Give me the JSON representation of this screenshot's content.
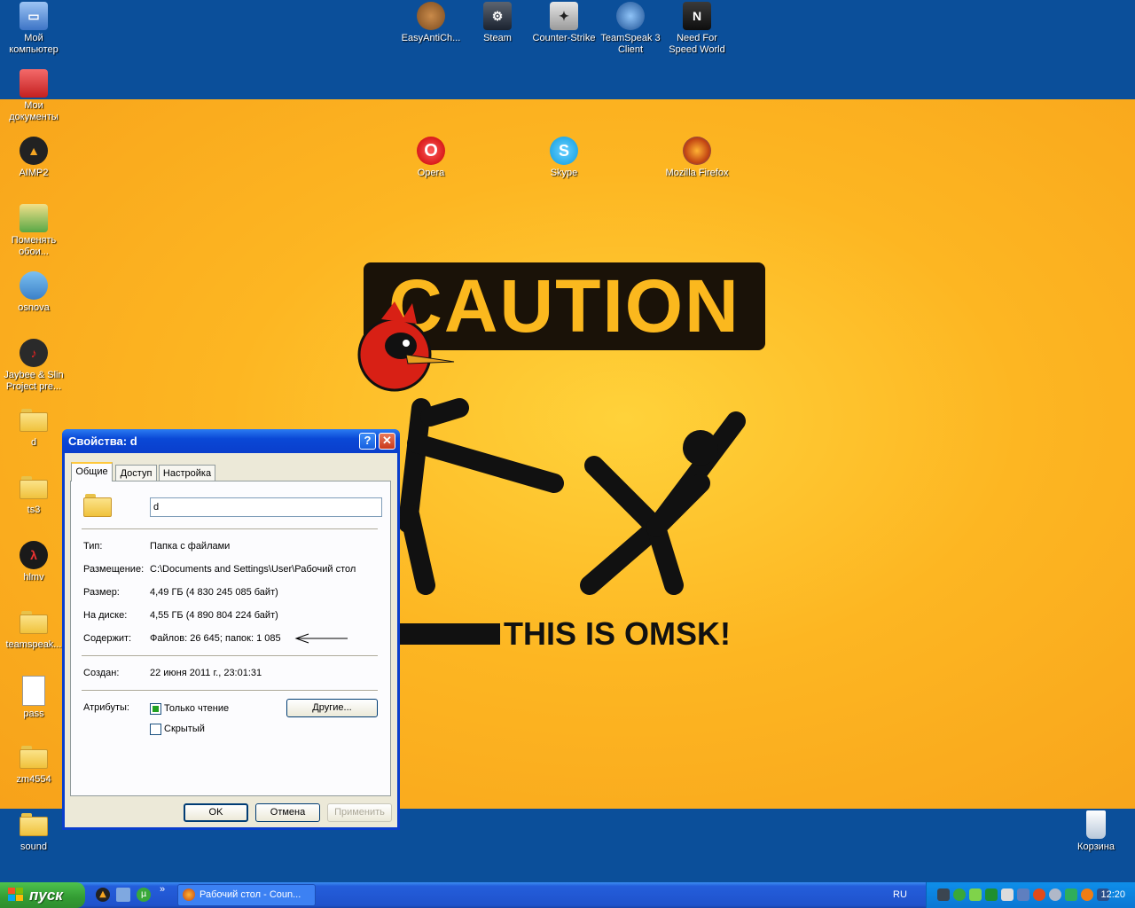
{
  "desktop": {
    "wallpaper": {
      "caution": "CAUTION",
      "omsk": "THIS IS OMSK!"
    },
    "icons_left": [
      {
        "label": "Мой компьютер",
        "icon": "my-computer-icon"
      },
      {
        "label": "Мои документы",
        "icon": "my-documents-icon"
      },
      {
        "label": "AIMP2",
        "icon": "aimp-icon"
      },
      {
        "label": "Поменять обои...",
        "icon": "wallpaper-changer-icon"
      },
      {
        "label": "osnova",
        "icon": "osnova-icon"
      },
      {
        "label": "Jaybee & Slin Project pre...",
        "icon": "mp3-icon"
      },
      {
        "label": "d",
        "icon": "folder-icon"
      },
      {
        "label": "ts3",
        "icon": "folder-icon"
      },
      {
        "label": "hlmv",
        "icon": "hlmv-icon"
      },
      {
        "label": "teamspeak...",
        "icon": "folder-icon"
      },
      {
        "label": "pass",
        "icon": "text-file-icon"
      },
      {
        "label": "zm4554",
        "icon": "folder-icon"
      },
      {
        "label": "sound",
        "icon": "folder-icon"
      }
    ],
    "icons_top": [
      {
        "label": "EasyAntiCh...",
        "icon": "teddy-bear-icon"
      },
      {
        "label": "Steam",
        "icon": "steam-icon"
      },
      {
        "label": "Counter-Strike",
        "icon": "counter-strike-icon"
      },
      {
        "label": "TeamSpeak 3 Client",
        "icon": "teamspeak-icon"
      },
      {
        "label": "Need For Speed World",
        "icon": "nfs-icon"
      }
    ],
    "icons_mid": [
      {
        "label": "Opera",
        "icon": "opera-icon"
      },
      {
        "label": "Skype",
        "icon": "skype-icon"
      },
      {
        "label": "Mozilla Firefox",
        "icon": "firefox-icon"
      }
    ],
    "recycle_bin": {
      "label": "Корзина",
      "icon": "recycle-bin-icon"
    }
  },
  "dialog": {
    "title": "Свойства: d",
    "help": "?",
    "close": "✕",
    "tabs": [
      "Общие",
      "Доступ",
      "Настройка"
    ],
    "name_value": "d",
    "rows": {
      "type_label": "Тип:",
      "type_value": "Папка с файлами",
      "location_label": "Размещение:",
      "location_value": "C:\\Documents and Settings\\User\\Рабочий стол",
      "size_label": "Размер:",
      "size_value": "4,49 ГБ (4 830 245 085 байт)",
      "disk_label": "На диске:",
      "disk_value": "4,55 ГБ (4 890 804 224 байт)",
      "contains_label": "Содержит:",
      "contains_value": "Файлов: 26 645; папок: 1 085",
      "created_label": "Создан:",
      "created_value": "22 июня 2011 г., 23:01:31",
      "attributes_label": "Атрибуты:"
    },
    "readonly_label": "Только чтение",
    "readonly_checked": true,
    "hidden_label": "Скрытый",
    "hidden_checked": false,
    "other_button": "Другие...",
    "ok": "OK",
    "cancel": "Отмена",
    "apply": "Применить"
  },
  "taskbar": {
    "start": "пуск",
    "quicklaunch": [
      "aimp-icon",
      "show-desktop-icon",
      "utorrent-icon"
    ],
    "more": "»",
    "task_label": "Рабочий стол - Coun...",
    "lang": "RU",
    "clock": "12:20"
  },
  "colors": {
    "desktop_blue": "#0b4f9a",
    "wallpaper_orange": "#fdb622",
    "xp_title_blue": "#0a48d6",
    "start_green": "#339c33"
  }
}
